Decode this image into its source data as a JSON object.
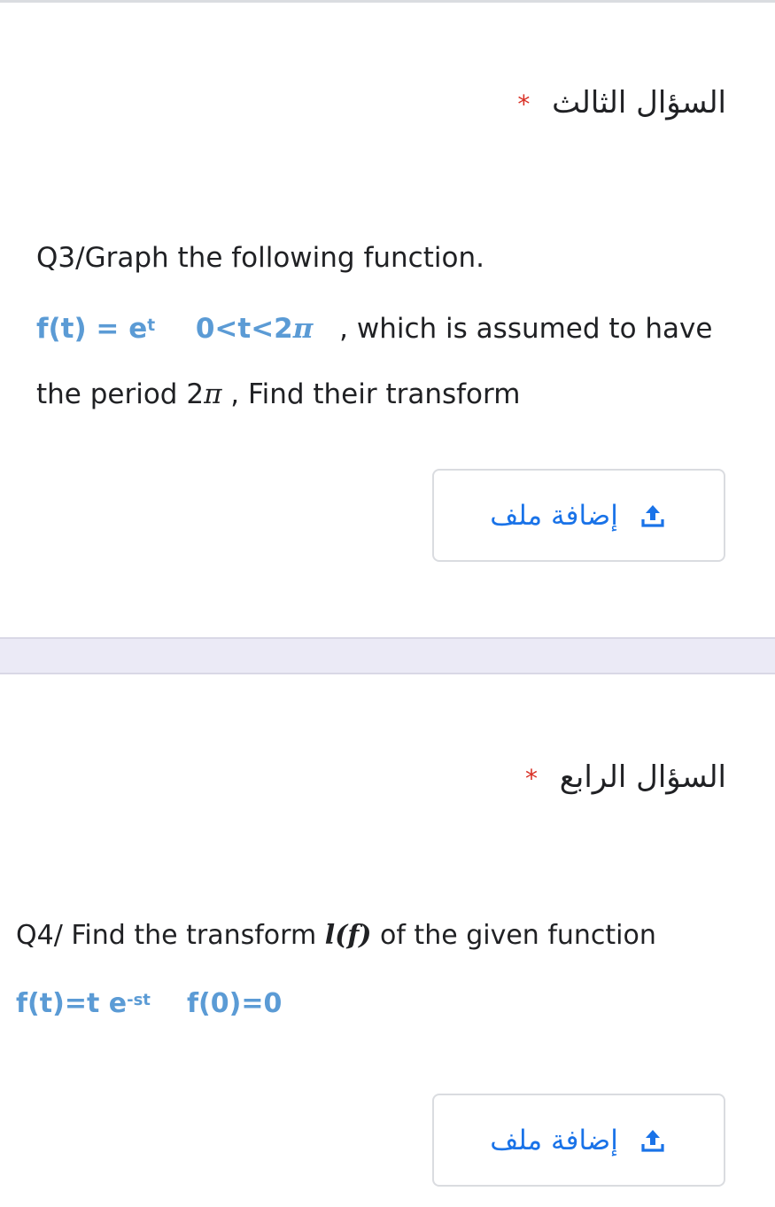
{
  "q3": {
    "title": "السؤال الثالث",
    "required_star": "*",
    "heading": "Q3/Graph the following function.",
    "func_prefix": "f(t) = e",
    "func_exp": "t",
    "func_range_pre": "0<t<2",
    "func_pi": "π",
    "func_suffix": " , which is assumed to have",
    "line3_pre": "the period  2",
    "line3_pi": "π",
    "line3_post": " , Find their transform",
    "upload_label": "إضافة ملف",
    "upload_icon": "upload-icon"
  },
  "q4": {
    "title": "السؤال الرابع",
    "required_star": "*",
    "heading_pre": "Q4/ Find the transform ",
    "heading_math": "l(f)",
    "heading_post": " of the given function",
    "func_pre": "f(t)=t e",
    "func_exp": "-st",
    "func_post": "f(0)=0",
    "upload_label": "إضافة ملف",
    "upload_icon": "upload-icon"
  },
  "colors": {
    "accent": "#1a73e8",
    "required": "#d93025",
    "formula_blue": "#5b9bd5",
    "separator": "#ebeaf6"
  }
}
